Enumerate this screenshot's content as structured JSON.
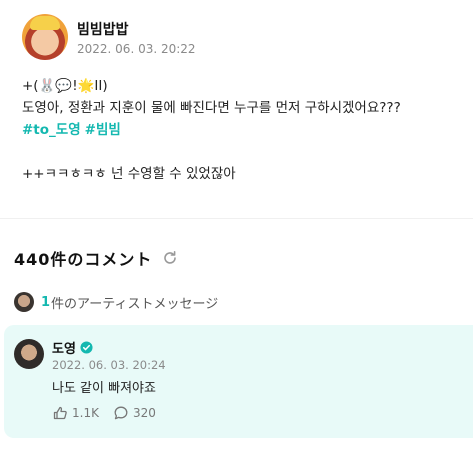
{
  "post": {
    "author": "빔빔밥밥",
    "date": "2022. 06. 03. 20:22",
    "lines": [
      "+(🐰💬!🌟II)",
      "도영아, 정환과 지훈이 물에 빠진다면 누구를 먼저 구하시겠어요???"
    ],
    "hashtags": [
      "#to_도영",
      "#빔빔"
    ],
    "last_line": "++ㅋㅋㅎㅋㅎ 넌 수영할 수 있었잖아"
  },
  "comments": {
    "title": "440件のコメント",
    "refresh_icon": "refresh-icon"
  },
  "artist_message": {
    "count": "1",
    "label": "件のアーティストメッセージ"
  },
  "comment": {
    "author": "도영",
    "date": "2022. 06. 03. 20:24",
    "text": "나도 같이 빠져야죠",
    "likes": "1.1K",
    "replies": "320",
    "badge_color": "#14b8b0"
  },
  "colors": {
    "accent": "#14b8b0",
    "card_bg": "#e8faf8"
  }
}
